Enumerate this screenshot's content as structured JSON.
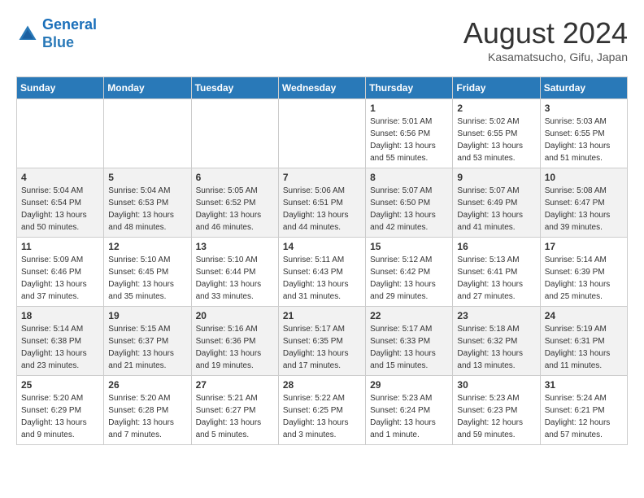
{
  "header": {
    "logo_line1": "General",
    "logo_line2": "Blue",
    "title": "August 2024",
    "subtitle": "Kasamatsucho, Gifu, Japan"
  },
  "days_of_week": [
    "Sunday",
    "Monday",
    "Tuesday",
    "Wednesday",
    "Thursday",
    "Friday",
    "Saturday"
  ],
  "weeks": [
    [
      {
        "day": "",
        "info": ""
      },
      {
        "day": "",
        "info": ""
      },
      {
        "day": "",
        "info": ""
      },
      {
        "day": "",
        "info": ""
      },
      {
        "day": "1",
        "info": "Sunrise: 5:01 AM\nSunset: 6:56 PM\nDaylight: 13 hours\nand 55 minutes."
      },
      {
        "day": "2",
        "info": "Sunrise: 5:02 AM\nSunset: 6:55 PM\nDaylight: 13 hours\nand 53 minutes."
      },
      {
        "day": "3",
        "info": "Sunrise: 5:03 AM\nSunset: 6:55 PM\nDaylight: 13 hours\nand 51 minutes."
      }
    ],
    [
      {
        "day": "4",
        "info": "Sunrise: 5:04 AM\nSunset: 6:54 PM\nDaylight: 13 hours\nand 50 minutes."
      },
      {
        "day": "5",
        "info": "Sunrise: 5:04 AM\nSunset: 6:53 PM\nDaylight: 13 hours\nand 48 minutes."
      },
      {
        "day": "6",
        "info": "Sunrise: 5:05 AM\nSunset: 6:52 PM\nDaylight: 13 hours\nand 46 minutes."
      },
      {
        "day": "7",
        "info": "Sunrise: 5:06 AM\nSunset: 6:51 PM\nDaylight: 13 hours\nand 44 minutes."
      },
      {
        "day": "8",
        "info": "Sunrise: 5:07 AM\nSunset: 6:50 PM\nDaylight: 13 hours\nand 42 minutes."
      },
      {
        "day": "9",
        "info": "Sunrise: 5:07 AM\nSunset: 6:49 PM\nDaylight: 13 hours\nand 41 minutes."
      },
      {
        "day": "10",
        "info": "Sunrise: 5:08 AM\nSunset: 6:47 PM\nDaylight: 13 hours\nand 39 minutes."
      }
    ],
    [
      {
        "day": "11",
        "info": "Sunrise: 5:09 AM\nSunset: 6:46 PM\nDaylight: 13 hours\nand 37 minutes."
      },
      {
        "day": "12",
        "info": "Sunrise: 5:10 AM\nSunset: 6:45 PM\nDaylight: 13 hours\nand 35 minutes."
      },
      {
        "day": "13",
        "info": "Sunrise: 5:10 AM\nSunset: 6:44 PM\nDaylight: 13 hours\nand 33 minutes."
      },
      {
        "day": "14",
        "info": "Sunrise: 5:11 AM\nSunset: 6:43 PM\nDaylight: 13 hours\nand 31 minutes."
      },
      {
        "day": "15",
        "info": "Sunrise: 5:12 AM\nSunset: 6:42 PM\nDaylight: 13 hours\nand 29 minutes."
      },
      {
        "day": "16",
        "info": "Sunrise: 5:13 AM\nSunset: 6:41 PM\nDaylight: 13 hours\nand 27 minutes."
      },
      {
        "day": "17",
        "info": "Sunrise: 5:14 AM\nSunset: 6:39 PM\nDaylight: 13 hours\nand 25 minutes."
      }
    ],
    [
      {
        "day": "18",
        "info": "Sunrise: 5:14 AM\nSunset: 6:38 PM\nDaylight: 13 hours\nand 23 minutes."
      },
      {
        "day": "19",
        "info": "Sunrise: 5:15 AM\nSunset: 6:37 PM\nDaylight: 13 hours\nand 21 minutes."
      },
      {
        "day": "20",
        "info": "Sunrise: 5:16 AM\nSunset: 6:36 PM\nDaylight: 13 hours\nand 19 minutes."
      },
      {
        "day": "21",
        "info": "Sunrise: 5:17 AM\nSunset: 6:35 PM\nDaylight: 13 hours\nand 17 minutes."
      },
      {
        "day": "22",
        "info": "Sunrise: 5:17 AM\nSunset: 6:33 PM\nDaylight: 13 hours\nand 15 minutes."
      },
      {
        "day": "23",
        "info": "Sunrise: 5:18 AM\nSunset: 6:32 PM\nDaylight: 13 hours\nand 13 minutes."
      },
      {
        "day": "24",
        "info": "Sunrise: 5:19 AM\nSunset: 6:31 PM\nDaylight: 13 hours\nand 11 minutes."
      }
    ],
    [
      {
        "day": "25",
        "info": "Sunrise: 5:20 AM\nSunset: 6:29 PM\nDaylight: 13 hours\nand 9 minutes."
      },
      {
        "day": "26",
        "info": "Sunrise: 5:20 AM\nSunset: 6:28 PM\nDaylight: 13 hours\nand 7 minutes."
      },
      {
        "day": "27",
        "info": "Sunrise: 5:21 AM\nSunset: 6:27 PM\nDaylight: 13 hours\nand 5 minutes."
      },
      {
        "day": "28",
        "info": "Sunrise: 5:22 AM\nSunset: 6:25 PM\nDaylight: 13 hours\nand 3 minutes."
      },
      {
        "day": "29",
        "info": "Sunrise: 5:23 AM\nSunset: 6:24 PM\nDaylight: 13 hours\nand 1 minute."
      },
      {
        "day": "30",
        "info": "Sunrise: 5:23 AM\nSunset: 6:23 PM\nDaylight: 12 hours\nand 59 minutes."
      },
      {
        "day": "31",
        "info": "Sunrise: 5:24 AM\nSunset: 6:21 PM\nDaylight: 12 hours\nand 57 minutes."
      }
    ]
  ]
}
